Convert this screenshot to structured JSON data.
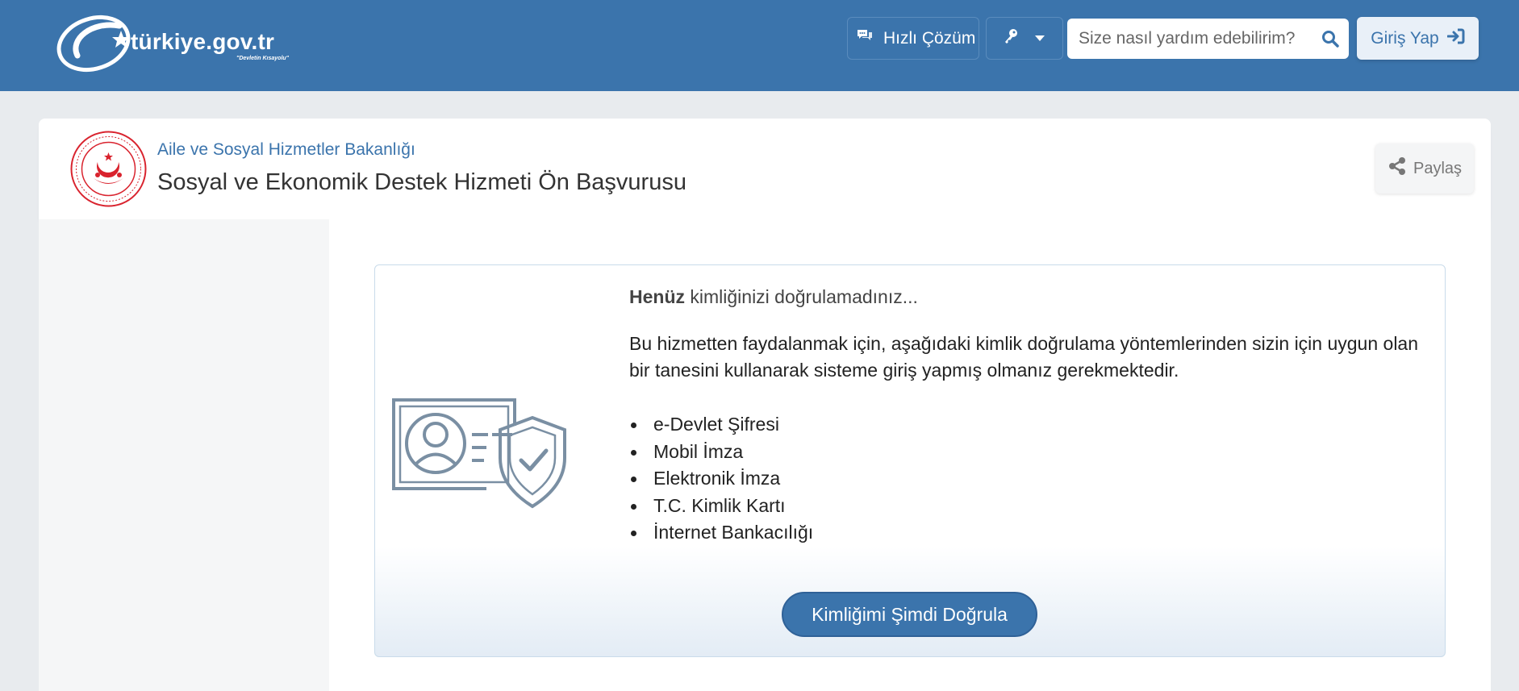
{
  "header": {
    "logo_text": "türkiye.gov.tr",
    "logo_tagline": "\"Devletin Kısayolu\"",
    "quick_solution_label": "Hızlı Çözüm",
    "search_placeholder": "Size nasıl yardım edebilirim?",
    "login_label": "Giriş Yap",
    "brand_color": "#3b74ac"
  },
  "service": {
    "ministry": "Aile ve Sosyal Hizmetler Bakanlığı",
    "title": "Sosyal ve Ekonomik Destek Hizmeti Ön Başvurusu",
    "share_label": "Paylaş"
  },
  "notice": {
    "title_bold": "Henüz",
    "title_rest": " kimliğinizi doğrulamadınız...",
    "description": "Bu hizmetten faydalanmak için, aşağıdaki kimlik doğrulama yöntemlerinden sizin için uygun olan bir tanesini kullanarak sisteme giriş yapmış olmanız gerekmektedir.",
    "methods": [
      "e-Devlet Şifresi",
      "Mobil İmza",
      "Elektronik İmza",
      "T.C. Kimlik Kartı",
      "İnternet Bankacılığı"
    ],
    "verify_button_label": "Kimliğimi Şimdi Doğrula"
  },
  "icons": [
    "chat-icon",
    "key-icon",
    "caret-down-icon",
    "search-icon",
    "sign-in-icon",
    "share-icon",
    "id-card-shield-icon",
    "ministry-emblem"
  ]
}
